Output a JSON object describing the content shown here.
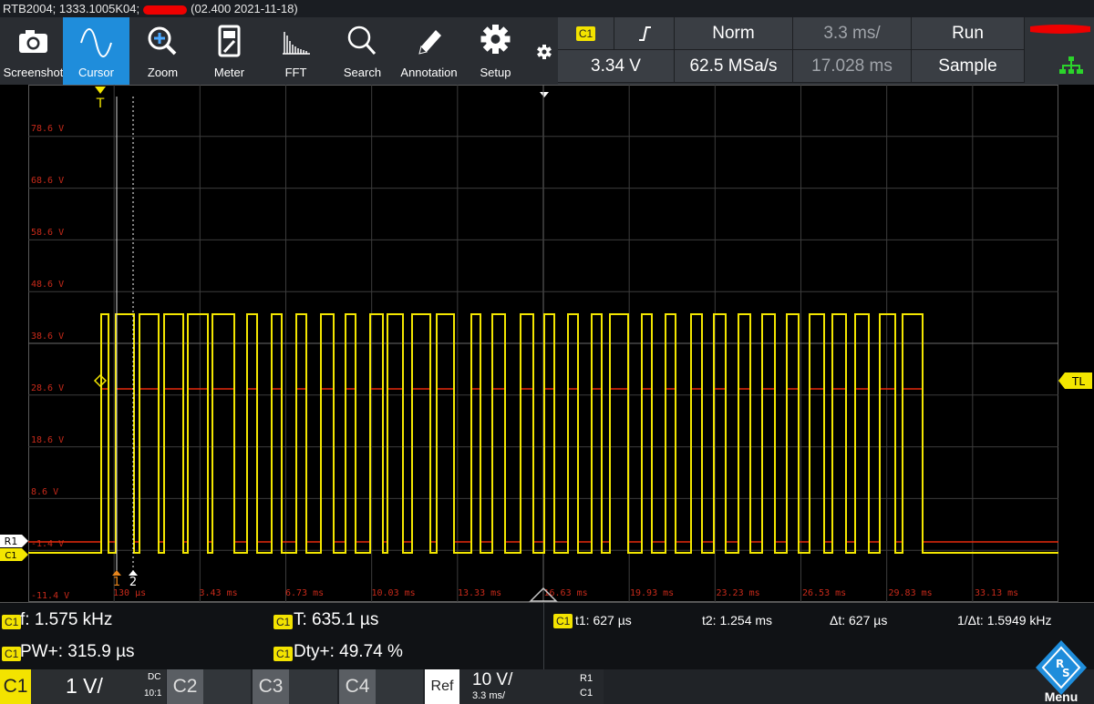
{
  "title": {
    "prefix": "RTB2004; 1333.1005K04;",
    "suffix": "(02.400 2021-11-18)"
  },
  "toolbar": [
    {
      "id": "screenshot",
      "label": "Screenshot",
      "icon": "camera-icon",
      "active": false
    },
    {
      "id": "cursor",
      "label": "Cursor",
      "icon": "sine-wave-icon",
      "active": true
    },
    {
      "id": "zoom",
      "label": "Zoom",
      "icon": "zoom-in-icon",
      "active": false
    },
    {
      "id": "meter",
      "label": "Meter",
      "icon": "meter-icon",
      "active": false
    },
    {
      "id": "fft",
      "label": "FFT",
      "icon": "fft-spectrum-icon",
      "active": false
    },
    {
      "id": "search",
      "label": "Search",
      "icon": "search-icon",
      "active": false
    },
    {
      "id": "annotation",
      "label": "Annotation",
      "icon": "pencil-icon",
      "active": false
    },
    {
      "id": "setup",
      "label": "Setup",
      "icon": "gear-icon",
      "active": false
    }
  ],
  "status": {
    "trigger_source": "C1",
    "trigger_slope_icon": "rising-edge-icon",
    "trigger_mode": "Norm",
    "timebase": "3.3 ms/",
    "run_state": "Run",
    "trigger_level": "3.34 V",
    "sample_rate": "62.5 MSa/s",
    "trigger_offset": "17.028 ms",
    "acquisition": "Sample"
  },
  "plot": {
    "trigger_marker": "T",
    "trigger_level_marker": "TL",
    "ref_marker": "R1",
    "ch_marker": "C1",
    "cursor1_label": "1",
    "cursor2_label": "2",
    "y_labels": [
      "78.6 V",
      "68.6 V",
      "58.6 V",
      "48.6 V",
      "38.6 V",
      "28.6 V",
      "18.6 V",
      "8.6 V",
      "-1.4 V",
      "-11.4 V"
    ],
    "x_labels": [
      "130 µs",
      "3.43 ms",
      "6.73 ms",
      "10.03 ms",
      "13.33 ms",
      "16.63 ms",
      "19.93 ms",
      "23.23 ms",
      "26.53 ms",
      "29.83 ms",
      "33.13 ms"
    ],
    "colors": {
      "ch1": "#f3e600",
      "ref": "#e82a0c",
      "axis_label": "#c82a1a",
      "grid": "#3c3c3c"
    }
  },
  "measurements": {
    "channel": "C1",
    "freq": "f: 1.575 kHz",
    "period": "T: 635.1 µs",
    "pwidth": "PW+: 315.9 µs",
    "duty": "Dty+: 49.74 %",
    "cursor_channel": "C1",
    "t1": "t1: 627 µs",
    "t2": "t2: 1.254 ms",
    "dt": "Δt: 627 µs",
    "inv_dt": "1/Δt: 1.5949 kHz"
  },
  "channels": {
    "c1": {
      "name": "C1",
      "scale": "1 V/",
      "coupling": "DC",
      "probe": "10:1"
    },
    "c2": {
      "name": "C2"
    },
    "c3": {
      "name": "C3"
    },
    "c4": {
      "name": "C4"
    },
    "ref": {
      "name": "Ref",
      "scale": "10 V/",
      "time": "3.3 ms/",
      "src_top": "R1",
      "src_bottom": "C1"
    }
  },
  "menu": {
    "label": "Menu",
    "logo": "rs-logo-icon"
  }
}
